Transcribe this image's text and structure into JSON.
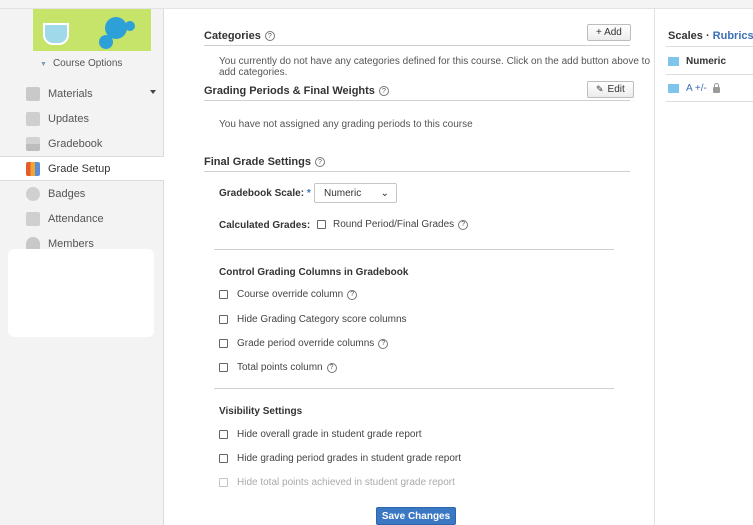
{
  "sidebar": {
    "course_options": "Course Options",
    "items": [
      {
        "label": "Materials",
        "icon": "materials-icon"
      },
      {
        "label": "Updates",
        "icon": "updates-icon"
      },
      {
        "label": "Gradebook",
        "icon": "gradebook-icon"
      },
      {
        "label": "Grade Setup",
        "icon": "grade-setup-icon",
        "active": true
      },
      {
        "label": "Badges",
        "icon": "badges-icon"
      },
      {
        "label": "Attendance",
        "icon": "attendance-icon"
      },
      {
        "label": "Members",
        "icon": "members-icon"
      }
    ]
  },
  "categories": {
    "title": "Categories",
    "add_label": "+ Add",
    "empty_line1": "You currently do not have any categories defined for this course. Click on the add button above to",
    "empty_line2": "add categories."
  },
  "grading_periods": {
    "title": "Grading Periods & Final Weights",
    "edit_label": "Edit",
    "empty": "You have not assigned any grading periods to this course"
  },
  "final_grade": {
    "title": "Final Grade Settings",
    "scale_label": "Gradebook Scale:",
    "required_mark": "*",
    "scale_value": "Numeric",
    "calculated_label": "Calculated Grades:",
    "round_label": "Round Period/Final Grades"
  },
  "control_columns": {
    "title": "Control Grading Columns in Gradebook",
    "options": [
      {
        "label": "Course override column",
        "help": true
      },
      {
        "label": "Hide Grading Category score columns",
        "help": false
      },
      {
        "label": "Grade period override columns",
        "help": true
      },
      {
        "label": "Total points column",
        "help": true
      }
    ]
  },
  "visibility": {
    "title": "Visibility Settings",
    "options": [
      {
        "label": "Hide overall grade in student grade report",
        "disabled": false
      },
      {
        "label": "Hide grading period grades in student grade report",
        "disabled": false
      },
      {
        "label": "Hide total points achieved in student grade report",
        "disabled": true
      }
    ]
  },
  "save_label": "Save Changes",
  "right_panel": {
    "scales": "Scales",
    "separator": "·",
    "rubrics": "Rubrics",
    "items": [
      "Numeric",
      "A +/-"
    ]
  },
  "help_glyph": "?",
  "colors": {
    "accent": "#3c6fb8",
    "save_button": "#3a78c4",
    "scale_swatch": "#7fc4ea"
  }
}
